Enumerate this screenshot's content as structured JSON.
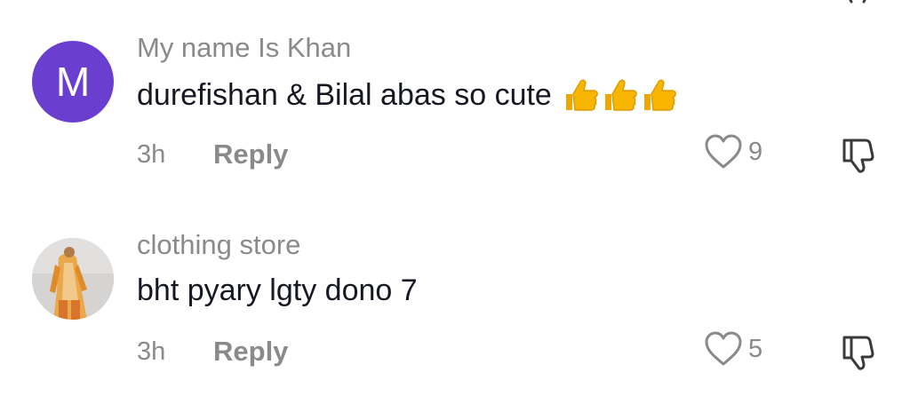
{
  "comments": [
    {
      "username": "My name Is Khan",
      "avatar_letter": "M",
      "avatar_color": "#6a3fd0",
      "text": "durefishan & Bilal abas so cute",
      "emojis": [
        "thumbs-up",
        "thumbs-up",
        "thumbs-up"
      ],
      "timestamp": "3h",
      "reply_label": "Reply",
      "like_count": "9"
    },
    {
      "username": "clothing store",
      "avatar_type": "photo",
      "text": "bht pyary lgty dono 7",
      "timestamp": "3h",
      "reply_label": "Reply",
      "like_count": "5"
    }
  ],
  "icons": {
    "like": "heart-outline-icon",
    "dislike": "thumbs-down-outline-icon",
    "emoji": "thumbs-up-emoji"
  },
  "colors": {
    "secondary_text": "#8a8a8a",
    "primary_text": "#161823",
    "emoji_yellow": "#f7b500"
  }
}
